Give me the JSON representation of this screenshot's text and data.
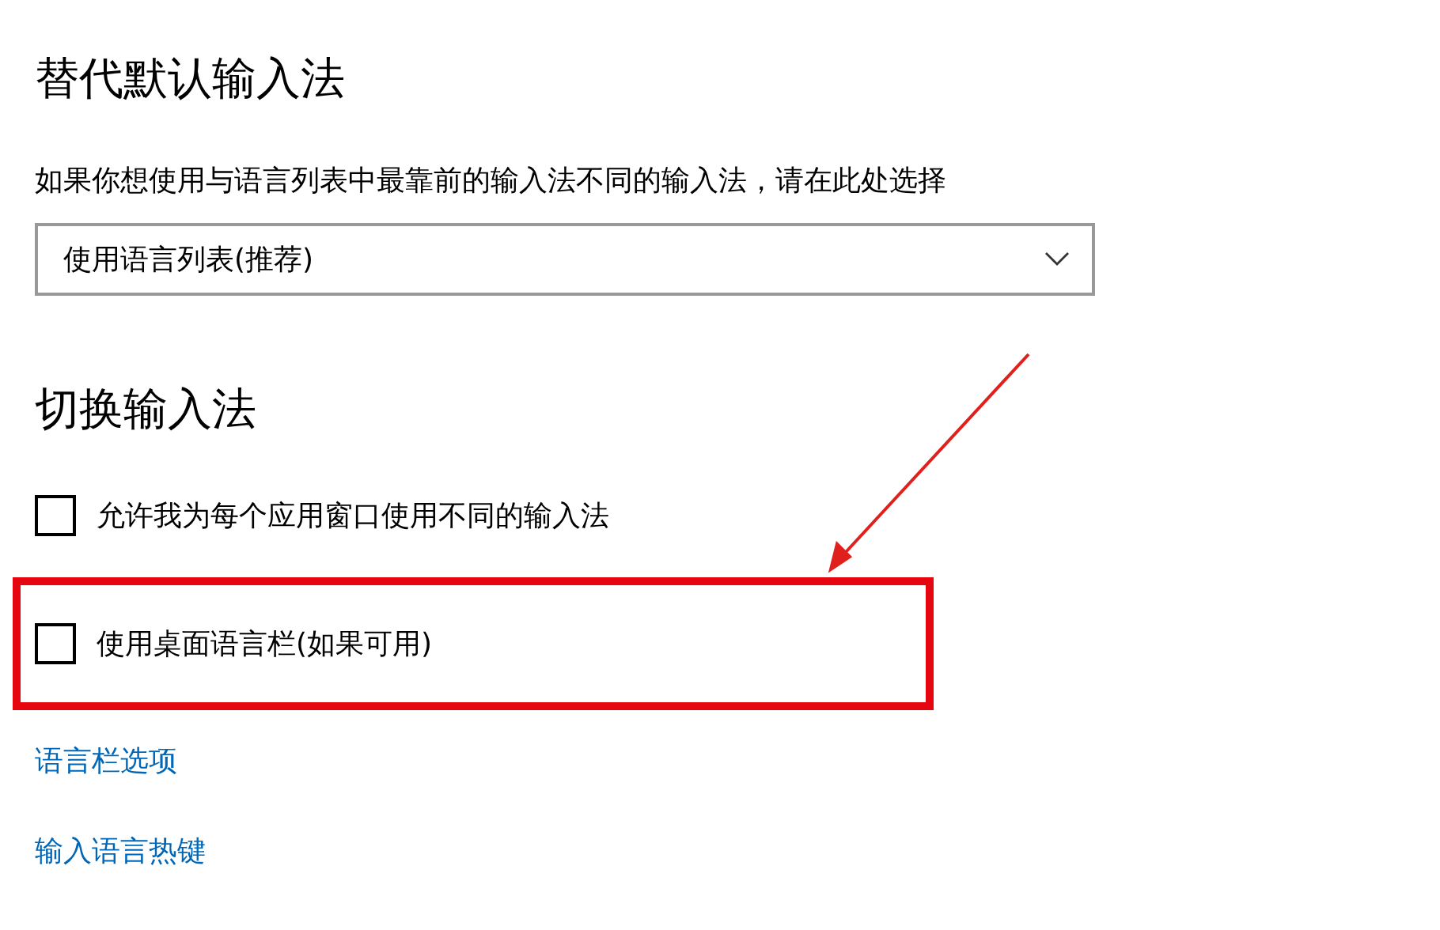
{
  "sections": [
    {
      "heading": "替代默认输入法",
      "description": "如果你想使用与语言列表中最靠前的输入法不同的输入法，请在此处选择",
      "dropdown": {
        "value": "使用语言列表(推荐)"
      }
    },
    {
      "heading": "切换输入法",
      "options": [
        {
          "label": "允许我为每个应用窗口使用不同的输入法",
          "checked": false,
          "highlighted": false
        },
        {
          "label": "使用桌面语言栏(如果可用)",
          "checked": false,
          "highlighted": true
        }
      ],
      "links": [
        "语言栏选项",
        "输入语言热键"
      ]
    }
  ]
}
